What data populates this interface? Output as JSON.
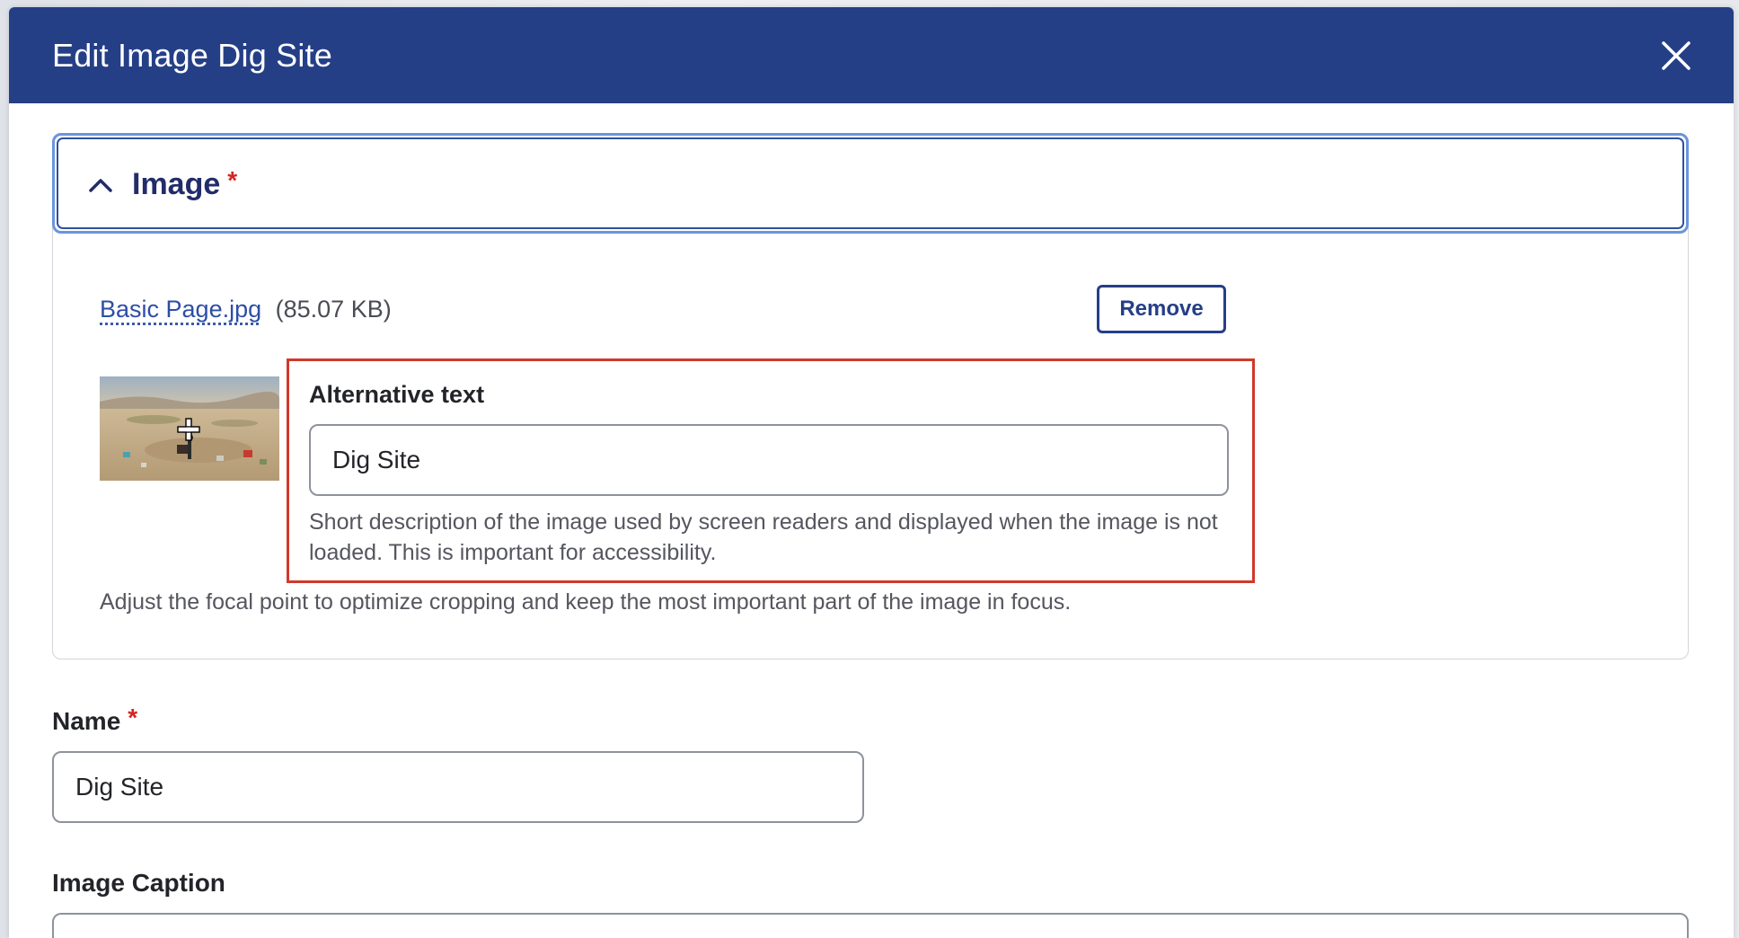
{
  "dialog": {
    "title": "Edit Image Dig Site",
    "close_icon": "close-icon",
    "header_color": "#253f87"
  },
  "image_section": {
    "title": "Image",
    "required_mark": "*",
    "expanded": true,
    "toggle_icon": "chevron-up-icon",
    "file": {
      "name": "Basic Page.jpg",
      "size": "(85.07 KB)"
    },
    "remove_label": "Remove",
    "thumbnail_icon": "focal-point-crosshair-icon",
    "alt_text": {
      "label": "Alternative text",
      "value": "Dig Site",
      "description": "Short description of the image used by screen readers and displayed when the image is not loaded. This is important for accessibility.",
      "highlight_color": "#d0392b"
    },
    "focal_description": "Adjust the focal point to optimize cropping and keep the most important part of the image in focus."
  },
  "name_field": {
    "label": "Name",
    "required_mark": "*",
    "value": "Dig Site"
  },
  "caption_field": {
    "label": "Image Caption",
    "value": ""
  }
}
